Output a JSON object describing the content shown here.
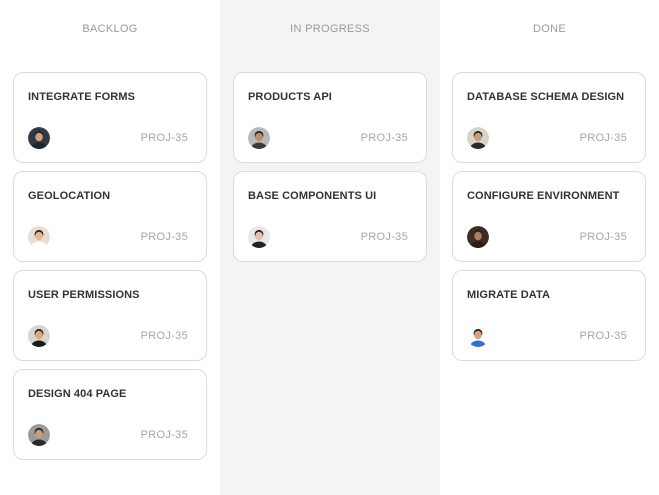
{
  "columns": [
    {
      "title": "BACKLOG",
      "cards": [
        {
          "title": "INTEGRATE FORMS",
          "id": "PROJ-35",
          "avatar_bg": "#2f3a44",
          "avatar_face": "#c9a283",
          "avatar_shirt": "#1e252c"
        },
        {
          "title": "GEOLOCATION",
          "id": "PROJ-35",
          "avatar_bg": "#e8ddd2",
          "avatar_face": "#e3b79a",
          "avatar_shirt": "#ffffff"
        },
        {
          "title": "USER PERMISSIONS",
          "id": "PROJ-35",
          "avatar_bg": "#d9d4cc",
          "avatar_face": "#d6a883",
          "avatar_shirt": "#1b1b1b"
        },
        {
          "title": "DESIGN 404 PAGE",
          "id": "PROJ-35",
          "avatar_bg": "#9a9a9a",
          "avatar_face": "#c89c7c",
          "avatar_shirt": "#2a2a2a"
        }
      ]
    },
    {
      "title": "IN PROGRESS",
      "cards": [
        {
          "title": "PRODUCTS API",
          "id": "PROJ-35",
          "avatar_bg": "#b9b9b9",
          "avatar_face": "#b78f72",
          "avatar_shirt": "#3a3a3a"
        },
        {
          "title": "BASE COMPONENTS UI",
          "id": "PROJ-35",
          "avatar_bg": "#e7e7e7",
          "avatar_face": "#e2c1a6",
          "avatar_shirt": "#222222"
        }
      ]
    },
    {
      "title": "DONE",
      "cards": [
        {
          "title": "DATABASE SCHEMA DESIGN",
          "id": "PROJ-35",
          "avatar_bg": "#d8d2c8",
          "avatar_face": "#c79d7c",
          "avatar_shirt": "#2a2a2a"
        },
        {
          "title": "CONFIGURE ENVIRONMENT",
          "id": "PROJ-35",
          "avatar_bg": "#3b2d25",
          "avatar_face": "#b07c5b",
          "avatar_shirt": "#2a1d16"
        },
        {
          "title": "MIGRATE DATA",
          "id": "PROJ-35",
          "avatar_bg": "#ffffff",
          "avatar_face": "#d9a07c",
          "avatar_shirt": "#2f6fd6"
        }
      ]
    }
  ]
}
